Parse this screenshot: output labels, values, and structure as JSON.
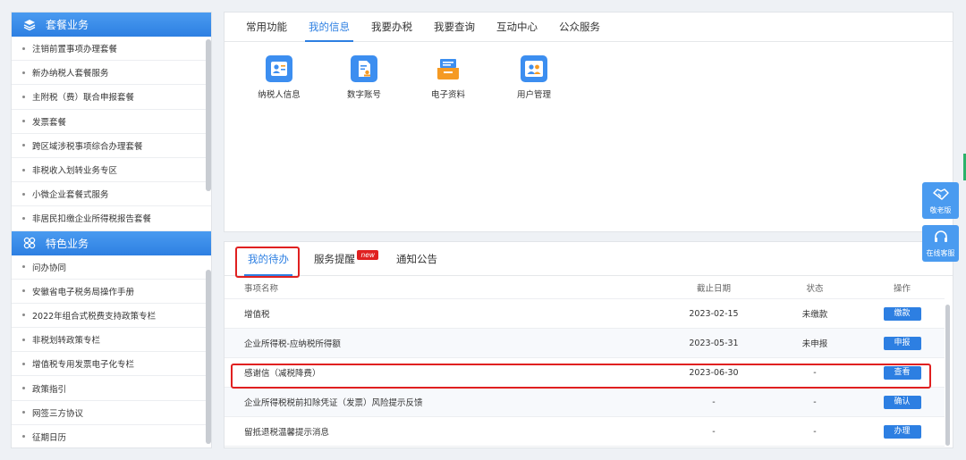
{
  "sidebar": {
    "section1_title": "套餐业务",
    "section1_items": [
      "注销前置事项办理套餐",
      "新办纳税人套餐服务",
      "主附税（费）联合申报套餐",
      "发票套餐",
      "跨区域涉税事项综合办理套餐",
      "非税收入划转业务专区",
      "小微企业套餐式服务",
      "非居民扣缴企业所得税报告套餐"
    ],
    "section2_title": "特色业务",
    "section2_items": [
      "问办协同",
      "安徽省电子税务局操作手册",
      "2022年组合式税费支持政策专栏",
      "非税划转政策专栏",
      "增值税专用发票电子化专栏",
      "政策指引",
      "网签三方协议",
      "征期日历"
    ]
  },
  "top_tabs": [
    "常用功能",
    "我的信息",
    "我要办税",
    "我要查询",
    "互动中心",
    "公众服务"
  ],
  "top_active_tab": 1,
  "tools": [
    {
      "label": "纳税人信息",
      "icon": "taxpayer-card-icon",
      "color": "#3c8ef0"
    },
    {
      "label": "数字账号",
      "icon": "digital-account-icon",
      "color": "#3c8ef0"
    },
    {
      "label": "电子资料",
      "icon": "e-docs-tray-icon",
      "color": "#f59a23"
    },
    {
      "label": "用户管理",
      "icon": "user-management-icon",
      "color": "#3c8ef0"
    }
  ],
  "todo": {
    "tabs": [
      "我的待办",
      "服务提醒",
      "通知公告"
    ],
    "new_badge": "new",
    "headers": {
      "name": "事项名称",
      "date": "截止日期",
      "status": "状态",
      "op": "操作"
    },
    "rows": [
      {
        "name": "增值税",
        "date": "2023-02-15",
        "status": "未缴款",
        "op": "缴款"
      },
      {
        "name": "企业所得税-应纳税所得额",
        "date": "2023-05-31",
        "status": "未申报",
        "op": "申报"
      },
      {
        "name": "感谢信（减税降费）",
        "date": "2023-06-30",
        "status": "-",
        "op": "查看"
      },
      {
        "name": "企业所得税税前扣除凭证（发票）风险提示反馈",
        "date": "-",
        "status": "-",
        "op": "确认"
      },
      {
        "name": "留抵退税温馨提示消息",
        "date": "-",
        "status": "-",
        "op": "办理"
      }
    ]
  },
  "float": {
    "elder_mode": "敬老版",
    "online_service": "在线客服"
  },
  "colors": {
    "accent": "#2d7fe2",
    "highlight_red": "#e02020"
  }
}
